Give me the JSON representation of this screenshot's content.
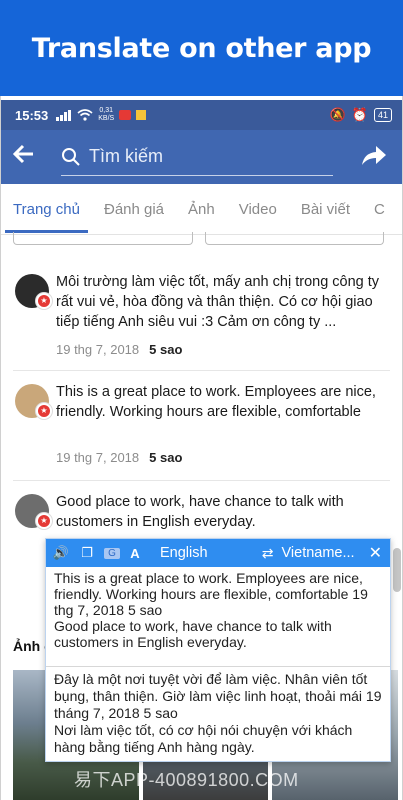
{
  "banner": {
    "title": "Translate on other app"
  },
  "status": {
    "time": "15:53",
    "speed_top": "0,31",
    "speed_bottom": "KB/S",
    "battery": "41"
  },
  "appbar": {
    "search_placeholder": "Tìm kiếm"
  },
  "tabs": [
    {
      "label": "Trang chủ",
      "active": true
    },
    {
      "label": "Đánh giá"
    },
    {
      "label": "Ảnh"
    },
    {
      "label": "Video"
    },
    {
      "label": "Bài viết"
    },
    {
      "label": "C"
    }
  ],
  "reviews": [
    {
      "text": "Môi trường làm việc tốt, mấy anh chị trong công ty rất vui vẻ, hòa đồng và thân thiện. Có cơ hội giao tiếp tiếng Anh siêu vui :3 Cảm ơn công ty ...",
      "date": "19 thg 7, 2018",
      "rating": "5 sao"
    },
    {
      "text": "This is a great place to work. Employees are nice, friendly. Working hours are flexible, comfortable",
      "date": "19 thg 7, 2018",
      "rating": "5 sao"
    },
    {
      "text": "Good place to work, have chance to talk with customers in English everyday."
    }
  ],
  "translate_popup": {
    "source_lang": "English",
    "target_lang": "Vietname...",
    "source_text": "This is a great place to work. Employees are nice, friendly. Working hours are flexible, comfortable 19 thg 7, 2018 5 sao\nGood place to work, have chance to talk with customers in English everyday.",
    "translated_text": "Đây là một nơi tuyệt vời để làm việc. Nhân viên tốt bụng, thân thiện. Giờ làm việc linh hoạt, thoải mái 19 tháng 7, 2018 5 sao\nNơi làm việc tốt, có cơ hội nói chuyện với khách hàng bằng tiếng Anh hàng ngày."
  },
  "photos_section": {
    "title": "Ảnh c"
  },
  "watermark": "易下APP-400891800.COM"
}
